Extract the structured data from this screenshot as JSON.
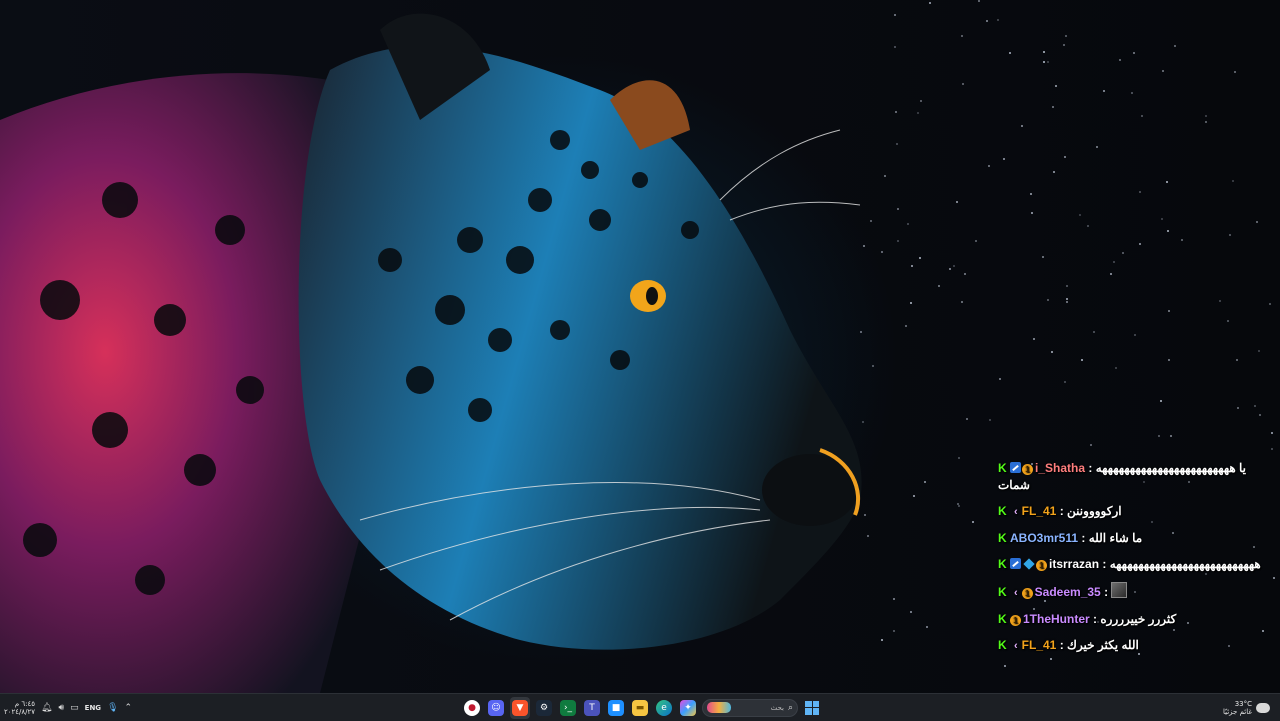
{
  "chat": {
    "messages": [
      {
        "user": "i_Shatha",
        "user_color": "#ff7e7e",
        "badges": [
          "kick-badge-icon",
          "verified-badge-icon",
          "coin-badge-icon"
        ],
        "separator": ":",
        "text": "يا ههههههههههههههههههههههههه",
        "text2": "شمات"
      },
      {
        "user": "FL_41",
        "user_color": "#f3a31b",
        "badges": [
          "kick-badge-icon",
          "chevron-badge-icon"
        ],
        "separator": ":",
        "text": "اركووووننن"
      },
      {
        "user": "ABO3mr511",
        "user_color": "#8ab4ff",
        "badges": [
          "kick-badge-icon"
        ],
        "separator": ":",
        "text": "ما شاء الله"
      },
      {
        "user": "itsrrazan",
        "user_color": "#ffffff",
        "badges": [
          "kick-badge-icon",
          "verified-badge-icon",
          "cube-badge-icon",
          "coin-badge-icon"
        ],
        "separator": ":",
        "text": "ههههههههههههههههههههههههههه"
      },
      {
        "user": "Sadeem_35",
        "user_color": "#c98bff",
        "badges": [
          "kick-badge-icon",
          "chevron-badge-icon",
          "coin-badge-icon"
        ],
        "separator": ":",
        "text": "",
        "has_image": true
      },
      {
        "user": "1TheHunter",
        "user_color": "#c98bff",
        "badges": [
          "kick-badge-icon",
          "coin-badge-icon"
        ],
        "separator": ":",
        "text": "كثررر خييرررره"
      },
      {
        "user": "FL_41",
        "user_color": "#f3a31b",
        "badges": [
          "kick-badge-icon",
          "chevron-badge-icon"
        ],
        "separator": ":",
        "text": "الله يكثر خيرك"
      }
    ]
  },
  "taskbar": {
    "clock_time": "٦:٤٥ م",
    "clock_date": "٢٠٢٤/٨/٢٧",
    "language": "ENG",
    "search_placeholder": "بحث",
    "weather_temp": "33°C",
    "weather_desc": "غائم جزئيًا",
    "apps": [
      "app-icon-1",
      "discord-icon",
      "brave-icon",
      "steam-icon",
      "terminal-icon",
      "teams-icon",
      "store-icon",
      "file-explorer-icon",
      "edge-icon",
      "copilot-icon"
    ]
  }
}
